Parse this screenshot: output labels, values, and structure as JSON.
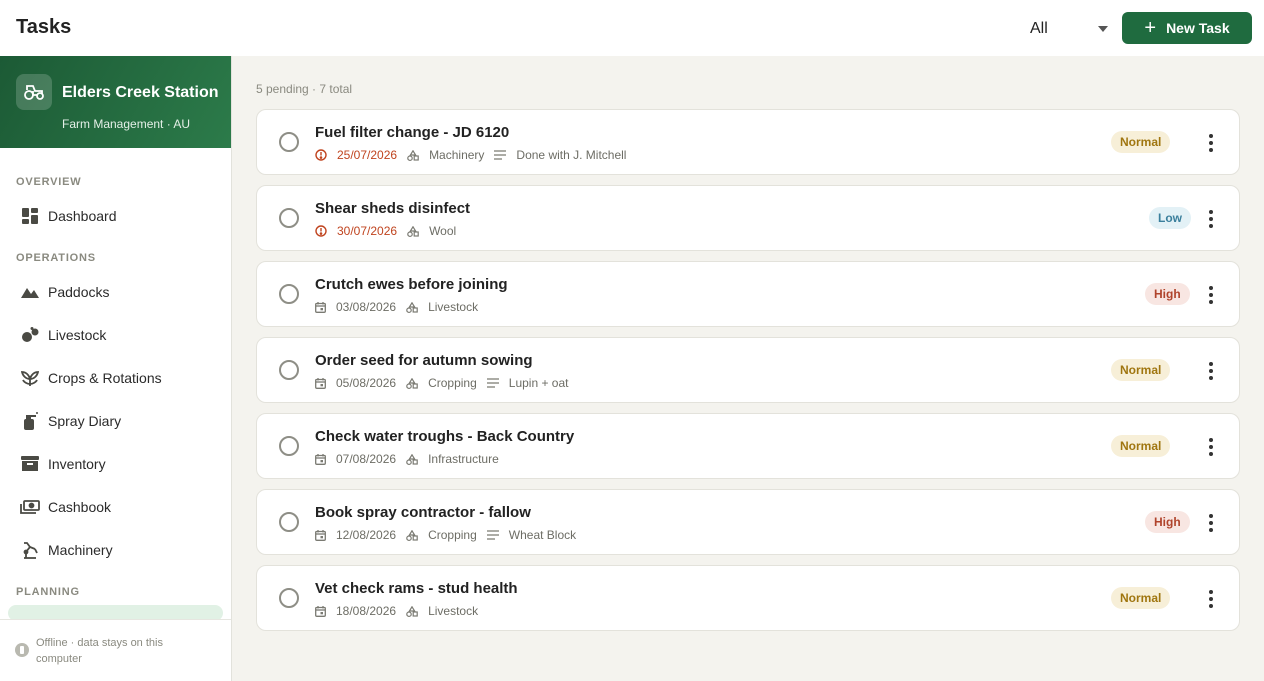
{
  "header": {
    "title": "Tasks",
    "filter_value": "All",
    "new_task_label": "New Task"
  },
  "farm": {
    "name": "Elders Creek Station",
    "subtitle": "Farm Management · AU"
  },
  "sidebar": {
    "sections": {
      "overview": "OVERVIEW",
      "operations": "OPERATIONS",
      "planning": "PLANNING"
    },
    "items": [
      {
        "label": "Dashboard",
        "icon": "dashboard-icon"
      },
      {
        "label": "Paddocks",
        "icon": "mountain-icon"
      },
      {
        "label": "Livestock",
        "icon": "livestock-icon"
      },
      {
        "label": "Crops & Rotations",
        "icon": "crop-icon"
      },
      {
        "label": "Spray Diary",
        "icon": "spray-icon"
      },
      {
        "label": "Inventory",
        "icon": "archive-icon"
      },
      {
        "label": "Cashbook",
        "icon": "cash-icon"
      },
      {
        "label": "Machinery",
        "icon": "machinery-icon"
      }
    ],
    "footer_text": "Offline · data stays on this computer"
  },
  "summary": "5 pending · 7 total",
  "tasks": [
    {
      "title": "Fuel filter change - JD 6120",
      "date": "25/07/2026",
      "overdue": true,
      "category": "Machinery",
      "note": "Done with J. Mitchell",
      "priority": "Normal"
    },
    {
      "title": "Shear sheds disinfect",
      "date": "30/07/2026",
      "overdue": true,
      "category": "Wool",
      "note": "",
      "priority": "Low"
    },
    {
      "title": "Crutch ewes before joining",
      "date": "03/08/2026",
      "overdue": false,
      "category": "Livestock",
      "note": "",
      "priority": "High"
    },
    {
      "title": "Order seed for autumn sowing",
      "date": "05/08/2026",
      "overdue": false,
      "category": "Cropping",
      "note": "Lupin + oat",
      "priority": "Normal"
    },
    {
      "title": "Check water troughs - Back Country",
      "date": "07/08/2026",
      "overdue": false,
      "category": "Infrastructure",
      "note": "",
      "priority": "Normal"
    },
    {
      "title": "Book spray contractor - fallow",
      "date": "12/08/2026",
      "overdue": false,
      "category": "Cropping",
      "note": "Wheat Block",
      "priority": "High"
    },
    {
      "title": "Vet check rams - stud health",
      "date": "18/08/2026",
      "overdue": false,
      "category": "Livestock",
      "note": "",
      "priority": "Normal"
    }
  ],
  "colors": {
    "accent": "#1f6b3f",
    "overdue": "#c0441f",
    "normal_badge": "#a07610",
    "low_badge": "#3a7f9c",
    "high_badge": "#b0442c"
  }
}
